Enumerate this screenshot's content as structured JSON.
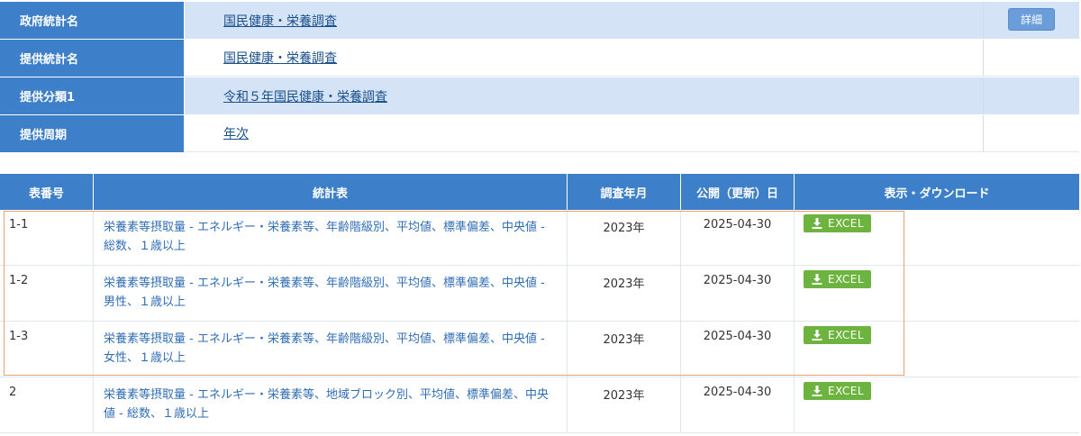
{
  "info": [
    {
      "label": "政府統計名",
      "value": "国民健康・栄養調査",
      "button": "詳細",
      "shaded": true
    },
    {
      "label": "提供統計名",
      "value": "国民健康・栄養調査",
      "shaded": false
    },
    {
      "label": "提供分類1",
      "value": "令和５年国民健康・栄養調査",
      "shaded": true
    },
    {
      "label": "提供周期",
      "value": "年次",
      "shaded": false
    }
  ],
  "table": {
    "headers": [
      "表番号",
      "統計表",
      "調査年月",
      "公開（更新）日",
      "表示・ダウンロード"
    ],
    "rows": [
      {
        "id": "1-1",
        "title": "栄養素等摂取量 - エネルギー・栄養素等、年齢階級別、平均値、標準偏差、中央値 - 総数、１歳以上",
        "year": "2023年",
        "date": "2025-04-30",
        "download": "EXCEL"
      },
      {
        "id": "1-2",
        "title": "栄養素等摂取量 - エネルギー・栄養素等、年齢階級別、平均値、標準偏差、中央値 - 男性、１歳以上",
        "year": "2023年",
        "date": "2025-04-30",
        "download": "EXCEL"
      },
      {
        "id": "1-3",
        "title": "栄養素等摂取量 - エネルギー・栄養素等、年齢階級別、平均値、標準偏差、中央値 - 女性、１歳以上",
        "year": "2023年",
        "date": "2025-04-30",
        "download": "EXCEL"
      },
      {
        "id": "2",
        "title": "栄養素等摂取量 - エネルギー・栄養素等、地域ブロック別、平均値、標準偏差、中央値 - 総数、１歳以上",
        "year": "2023年",
        "date": "2025-04-30",
        "download": "EXCEL"
      }
    ]
  },
  "colors": {
    "header": "#3d7fc9",
    "shaded": "#d4e3f5",
    "excel": "#6db33f",
    "link": "#2f6db5",
    "highlight": "#f0a06a"
  },
  "icons": {
    "download": "download-icon"
  }
}
